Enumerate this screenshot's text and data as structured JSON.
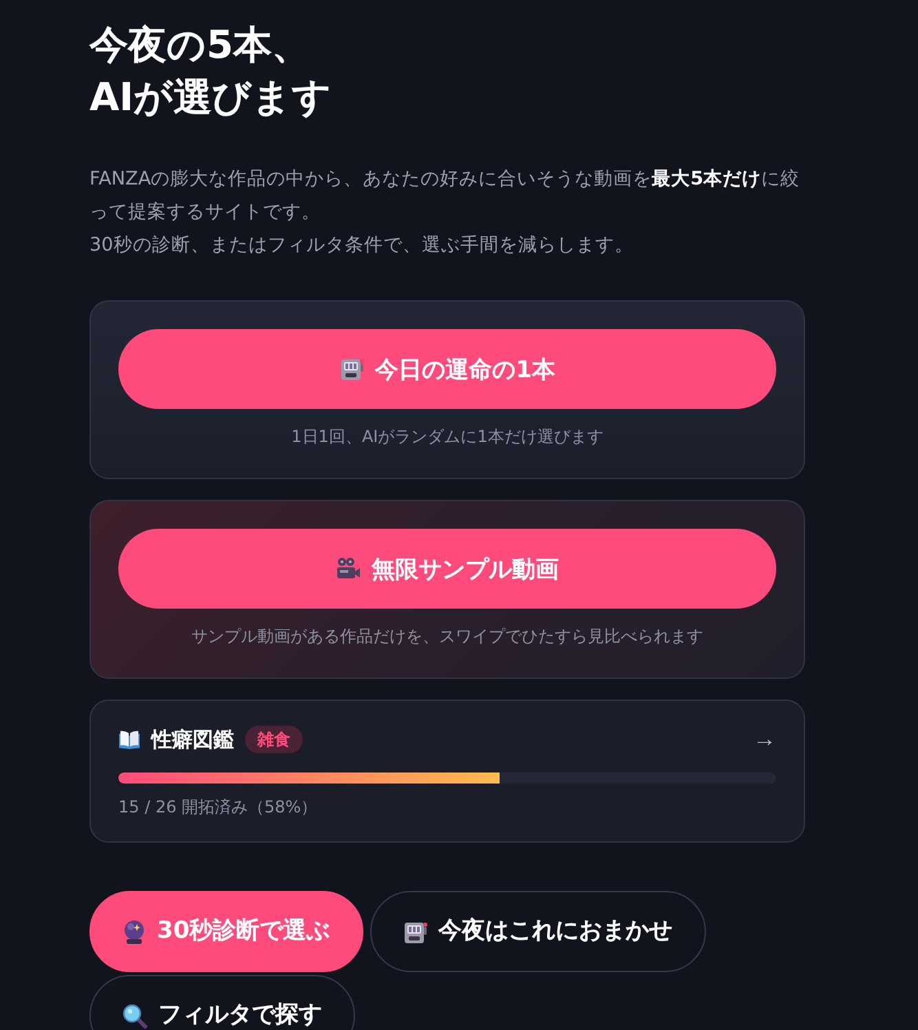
{
  "hero": {
    "title_lines": [
      "今夜の5本、",
      "AIが選びます"
    ],
    "description_lines": [
      "FANZAの膨大な作品の中から、あなたの好みに合いそうな動画を**最大5本だけ**に絞って提案するサイトです。",
      "30秒の診断、またはフィルタ条件で、選ぶ手間を減らします。"
    ]
  },
  "feature_cards": [
    {
      "kind": "plain",
      "button": "今日の運命の1本",
      "caption": "1日1回、AIがランダムに1本だけ選びます"
    },
    {
      "kind": "tinted",
      "button": "無限サンプル動画",
      "caption": "サンプル動画がある作品だけを、スワイプでひたすら見比べられます"
    }
  ],
  "collection": {
    "title": "性癖図鑑",
    "badge": "雑食",
    "arrow": "→",
    "level": 0.58,
    "progress_text": "15 / 26 開拓済み（58%）"
  },
  "actions": [
    {
      "label": "30秒診断で選ぶ",
      "kind": "primary"
    },
    {
      "label": "今夜はこれにおまかせ",
      "kind": "secondary"
    },
    {
      "label": "フィルタで探す",
      "kind": "secondary"
    }
  ]
}
